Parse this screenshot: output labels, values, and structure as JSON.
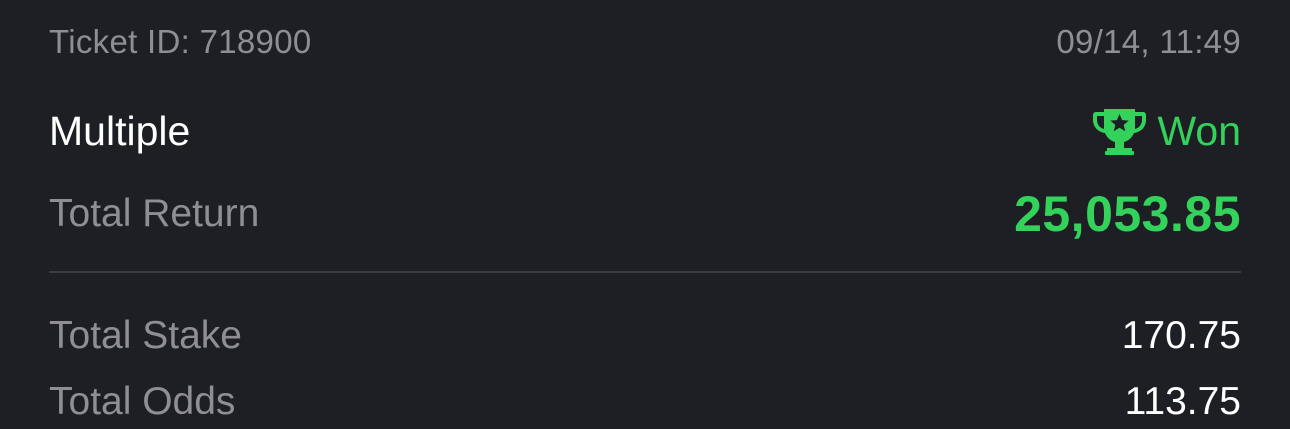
{
  "ticket": {
    "id_label": "Ticket ID: 718900",
    "datetime": "09/14, 11:49",
    "bet_type": "Multiple",
    "status": "Won",
    "status_icon": "trophy-icon",
    "status_color": "#32d25b"
  },
  "summary": {
    "total_return_label": "Total Return",
    "total_return_value": "25,053.85",
    "total_stake_label": "Total Stake",
    "total_stake_value": "170.75",
    "total_odds_label": "Total Odds",
    "total_odds_value": "113.75"
  }
}
